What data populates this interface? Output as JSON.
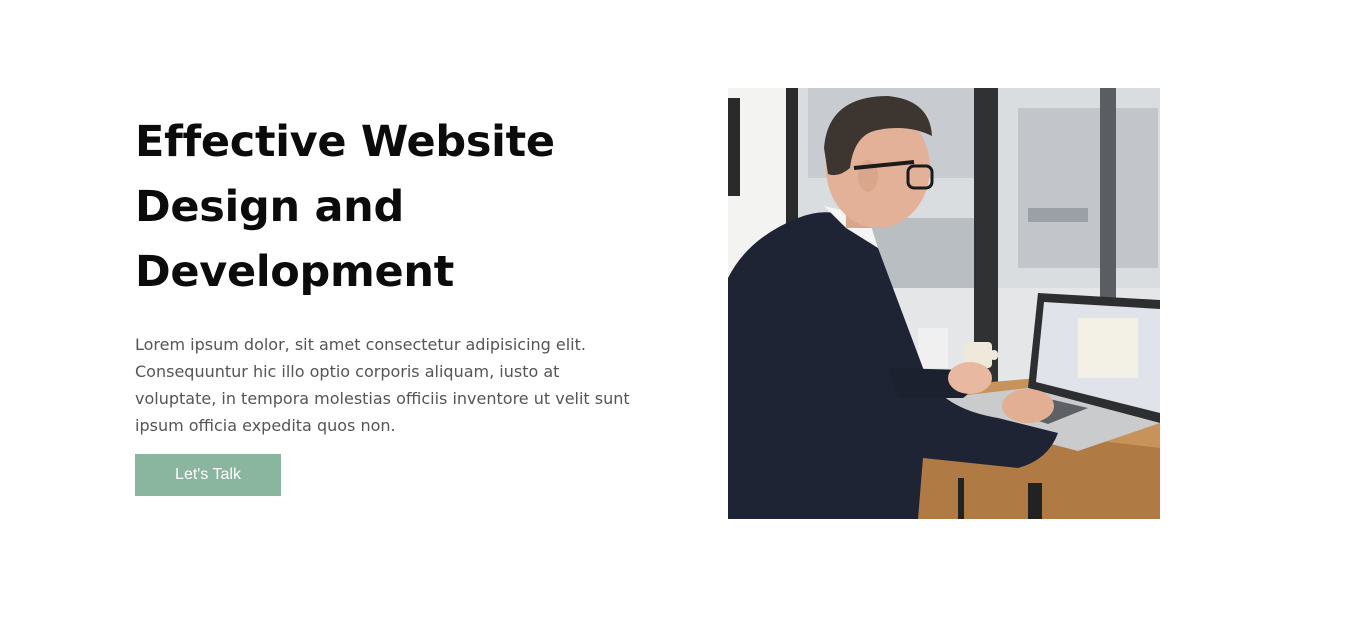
{
  "hero": {
    "title_lines": [
      "Effective Website",
      "Design and",
      "Development"
    ],
    "description": "Lorem ipsum dolor, sit amet consectetur adipisicing elit. Consequuntur hic illo optio corporis aliquam, iusto at voluptate, in tempora molestias officiis inventore ut velit sunt ipsum officia expedita quos non.",
    "cta_label": "Let's Talk"
  },
  "image": {
    "subject": "man-working-on-laptop-photo"
  },
  "colors": {
    "accent": "#8ab59e",
    "heading": "#0b0b0b",
    "body_text": "#555555",
    "background": "#ffffff"
  }
}
